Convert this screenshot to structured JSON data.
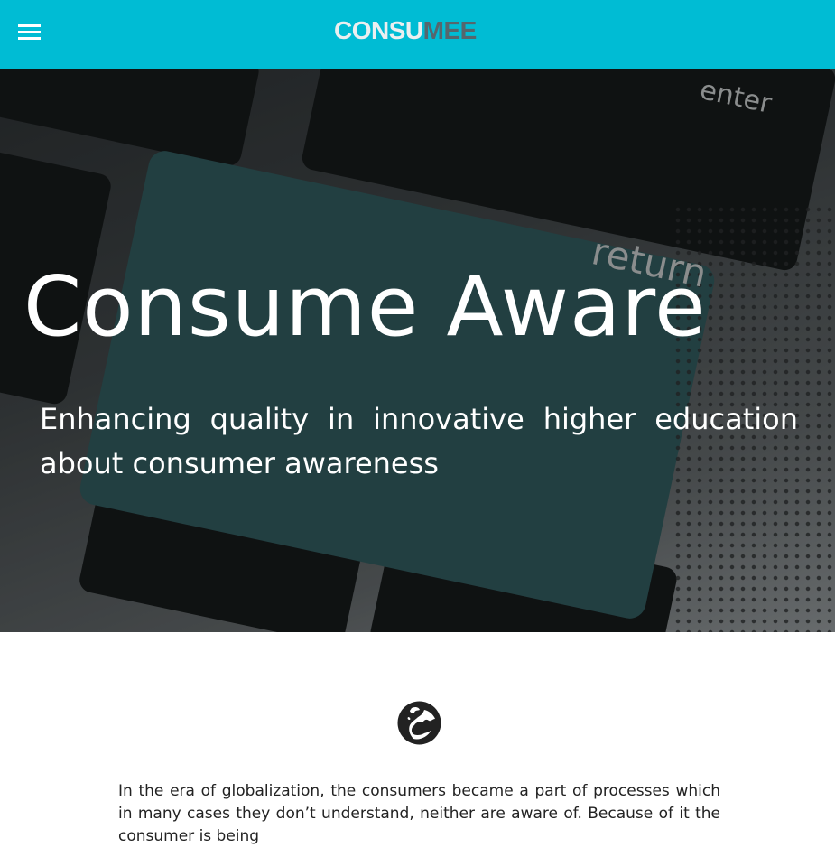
{
  "header": {
    "menu_icon": "hamburger-icon",
    "logo_part1": "CONSU",
    "logo_part2": "MEE",
    "bg_color": "#00bcd4"
  },
  "hero": {
    "title": "Consume Aware",
    "subtitle": "Enhancing quality in innovative higher education about consumer awareness",
    "key_enter": "enter",
    "key_return": "return"
  },
  "intro": {
    "icon": "globe-icon",
    "text": "In the era of globalization, the consumers became a part of processes which in many cases they don’t understand, neither are aware of. Because of it the consumer is being"
  }
}
